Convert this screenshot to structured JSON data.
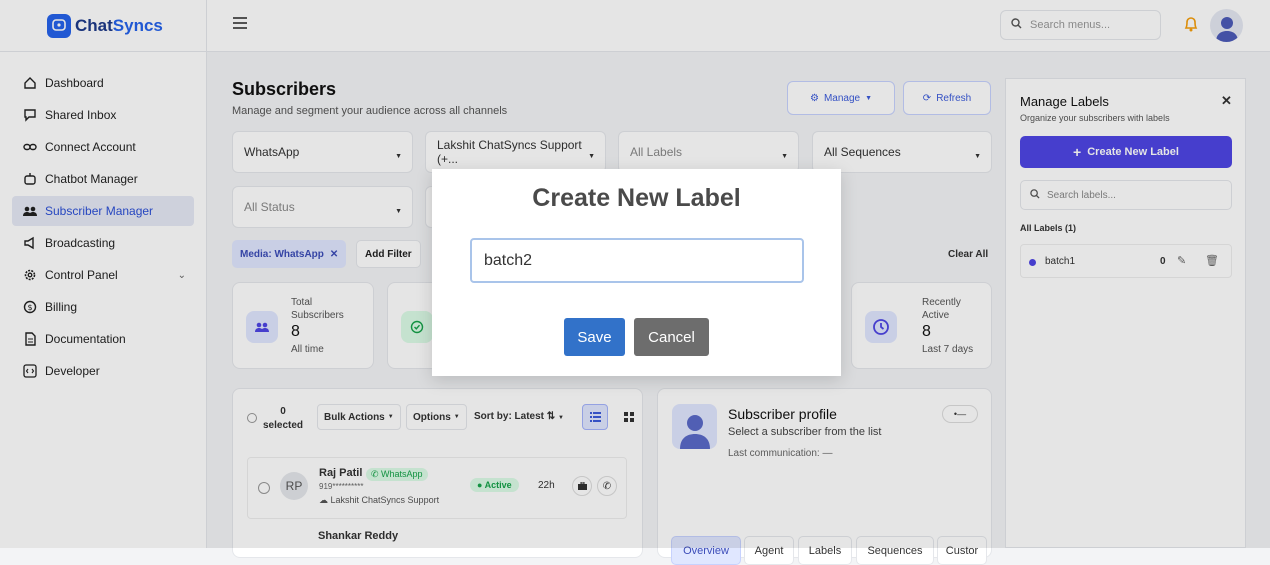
{
  "brand": {
    "name_a": "Chat",
    "name_b": "Syncs"
  },
  "sidebar": {
    "items": [
      {
        "label": "Dashboard"
      },
      {
        "label": "Shared Inbox"
      },
      {
        "label": "Connect Account"
      },
      {
        "label": "Chatbot Manager"
      },
      {
        "label": "Subscriber Manager"
      },
      {
        "label": "Broadcasting"
      },
      {
        "label": "Control Panel"
      },
      {
        "label": "Billing"
      },
      {
        "label": "Documentation"
      },
      {
        "label": "Developer"
      }
    ],
    "active": "Subscriber Manager"
  },
  "topbar": {
    "search_placeholder": "Search menus..."
  },
  "page": {
    "title": "Subscribers",
    "subtitle": "Manage and segment your audience across all channels",
    "manage_label": "Manage",
    "refresh_label": "Refresh"
  },
  "filters": {
    "channel": "WhatsApp",
    "account": "Lakshit ChatSyncs Support (+...",
    "labels": "All Labels",
    "sequences": "All Sequences",
    "status": "All Status"
  },
  "chips": {
    "media": "Media: WhatsApp",
    "add_filter": "Add Filter",
    "clear_all": "Clear All"
  },
  "stats": {
    "total": {
      "label1": "Total",
      "label2": "Subscribers",
      "value": "8",
      "sub": "All time"
    },
    "recent": {
      "label1": "Recently",
      "label2": "Active",
      "value": "8",
      "sub": "Last 7 days"
    }
  },
  "list": {
    "selected_count": "0",
    "selected_label": "selected",
    "bulk_actions": "Bulk Actions",
    "options": "Options",
    "sort": "Sort by: Latest",
    "rows": [
      {
        "initials": "RP",
        "name": "Raj Patil",
        "channel": "WhatsApp",
        "phone": "919**********",
        "account": "Lakshit ChatSyncs Support",
        "status": "Active",
        "time": "22h"
      },
      {
        "name": "Shankar Reddy"
      }
    ]
  },
  "profile": {
    "title": "Subscriber profile",
    "hint": "Select a subscriber from the list",
    "last_comm_label": "Last communication:",
    "last_comm_value": "—",
    "badge": "—",
    "tabs": [
      "Overview",
      "Agent",
      "Labels",
      "Sequences",
      "Custor"
    ]
  },
  "labels_panel": {
    "title": "Manage Labels",
    "subtitle": "Organize your subscribers with labels",
    "create_label": "Create New Label",
    "search_placeholder": "Search labels...",
    "section": "All Labels (1)",
    "items": [
      {
        "name": "batch1",
        "count": "0"
      }
    ]
  },
  "modal": {
    "title": "Create New Label",
    "input_value": "batch2",
    "save": "Save",
    "cancel": "Cancel"
  },
  "colors": {
    "primary": "#2563eb",
    "accent": "#4f46e5",
    "save": "#3272c9",
    "cancel": "#6d6d6d"
  }
}
